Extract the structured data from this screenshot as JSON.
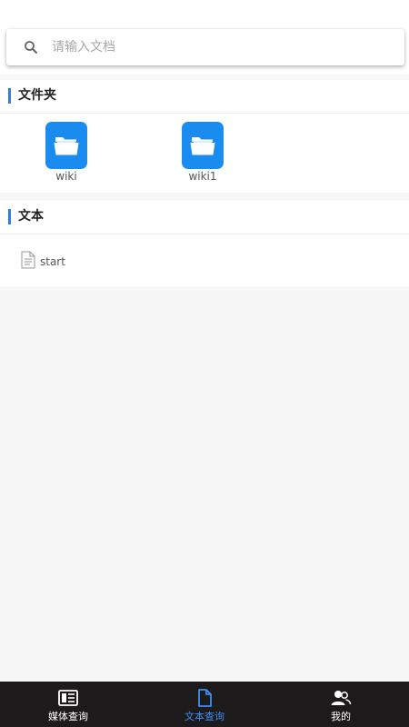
{
  "search": {
    "placeholder": "请输入文档",
    "icon": "search-icon"
  },
  "folders_section": {
    "title": "文件夹",
    "accent": "#2f7fe0",
    "items": [
      {
        "label": "wiki",
        "icon": "folder-icon"
      },
      {
        "label": "wiki1",
        "icon": "folder-icon"
      }
    ]
  },
  "texts_section": {
    "title": "文本",
    "items": [
      {
        "label": "start",
        "icon": "document-icon"
      }
    ]
  },
  "bottom_nav": {
    "items": [
      {
        "label": "媒体查询",
        "icon": "media-icon",
        "active": false
      },
      {
        "label": "文本查询",
        "icon": "document-icon",
        "active": true
      },
      {
        "label": "我的",
        "icon": "user-group-icon",
        "active": false
      }
    ],
    "active_color": "#3f8df2",
    "background": "#1c1a1b"
  },
  "colors": {
    "folder_tile": "#1a8cf0",
    "page_background": "#f7f7f7"
  }
}
